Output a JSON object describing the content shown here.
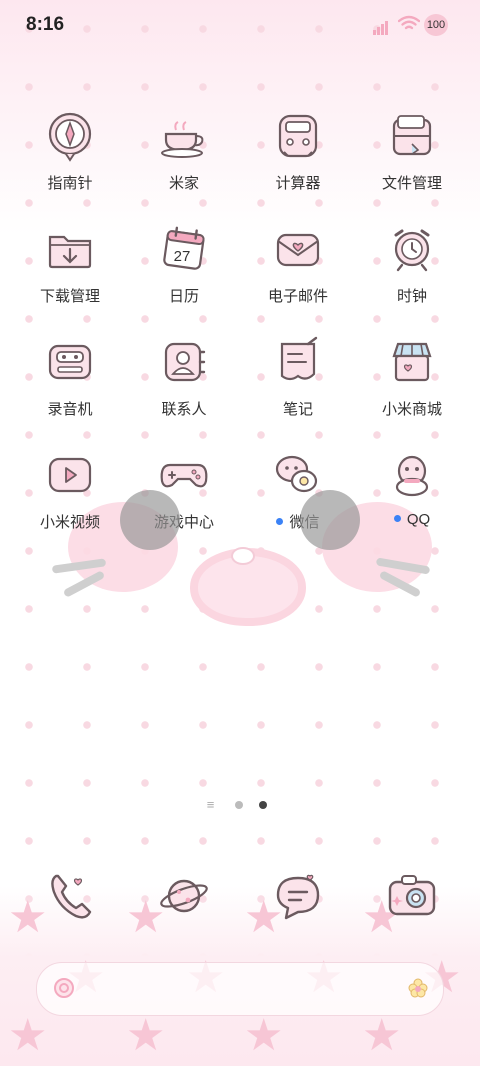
{
  "status_bar": {
    "time": "8:16",
    "battery": "100"
  },
  "apps": [
    {
      "name": "指南针",
      "icon": "compass-icon"
    },
    {
      "name": "米家",
      "icon": "teacup-icon"
    },
    {
      "name": "计算器",
      "icon": "calculator-icon"
    },
    {
      "name": "文件管理",
      "icon": "folder-icon"
    },
    {
      "name": "下载管理",
      "icon": "download-folder-icon"
    },
    {
      "name": "日历",
      "icon": "calendar-icon",
      "date": "27"
    },
    {
      "name": "电子邮件",
      "icon": "mail-icon"
    },
    {
      "name": "时钟",
      "icon": "alarm-clock-icon"
    },
    {
      "name": "录音机",
      "icon": "cassette-icon"
    },
    {
      "name": "联系人",
      "icon": "contacts-icon"
    },
    {
      "name": "笔记",
      "icon": "notes-icon"
    },
    {
      "name": "小米商城",
      "icon": "shop-icon"
    },
    {
      "name": "小米视频",
      "icon": "video-icon"
    },
    {
      "name": "游戏中心",
      "icon": "gamepad-icon"
    },
    {
      "name": "微信",
      "icon": "wechat-icon",
      "notification": true
    },
    {
      "name": "QQ",
      "icon": "qq-icon",
      "notification": true
    }
  ],
  "page_indicator": {
    "pages": 2,
    "active": 2
  },
  "dock": [
    {
      "icon": "phone-icon"
    },
    {
      "icon": "planet-browser-icon"
    },
    {
      "icon": "message-icon"
    },
    {
      "icon": "camera-icon"
    }
  ],
  "colors": {
    "accent": "#f4a9bf",
    "outline": "#6b5a5f",
    "fill": "#fbe3ea",
    "notification": "#3b82f6"
  }
}
